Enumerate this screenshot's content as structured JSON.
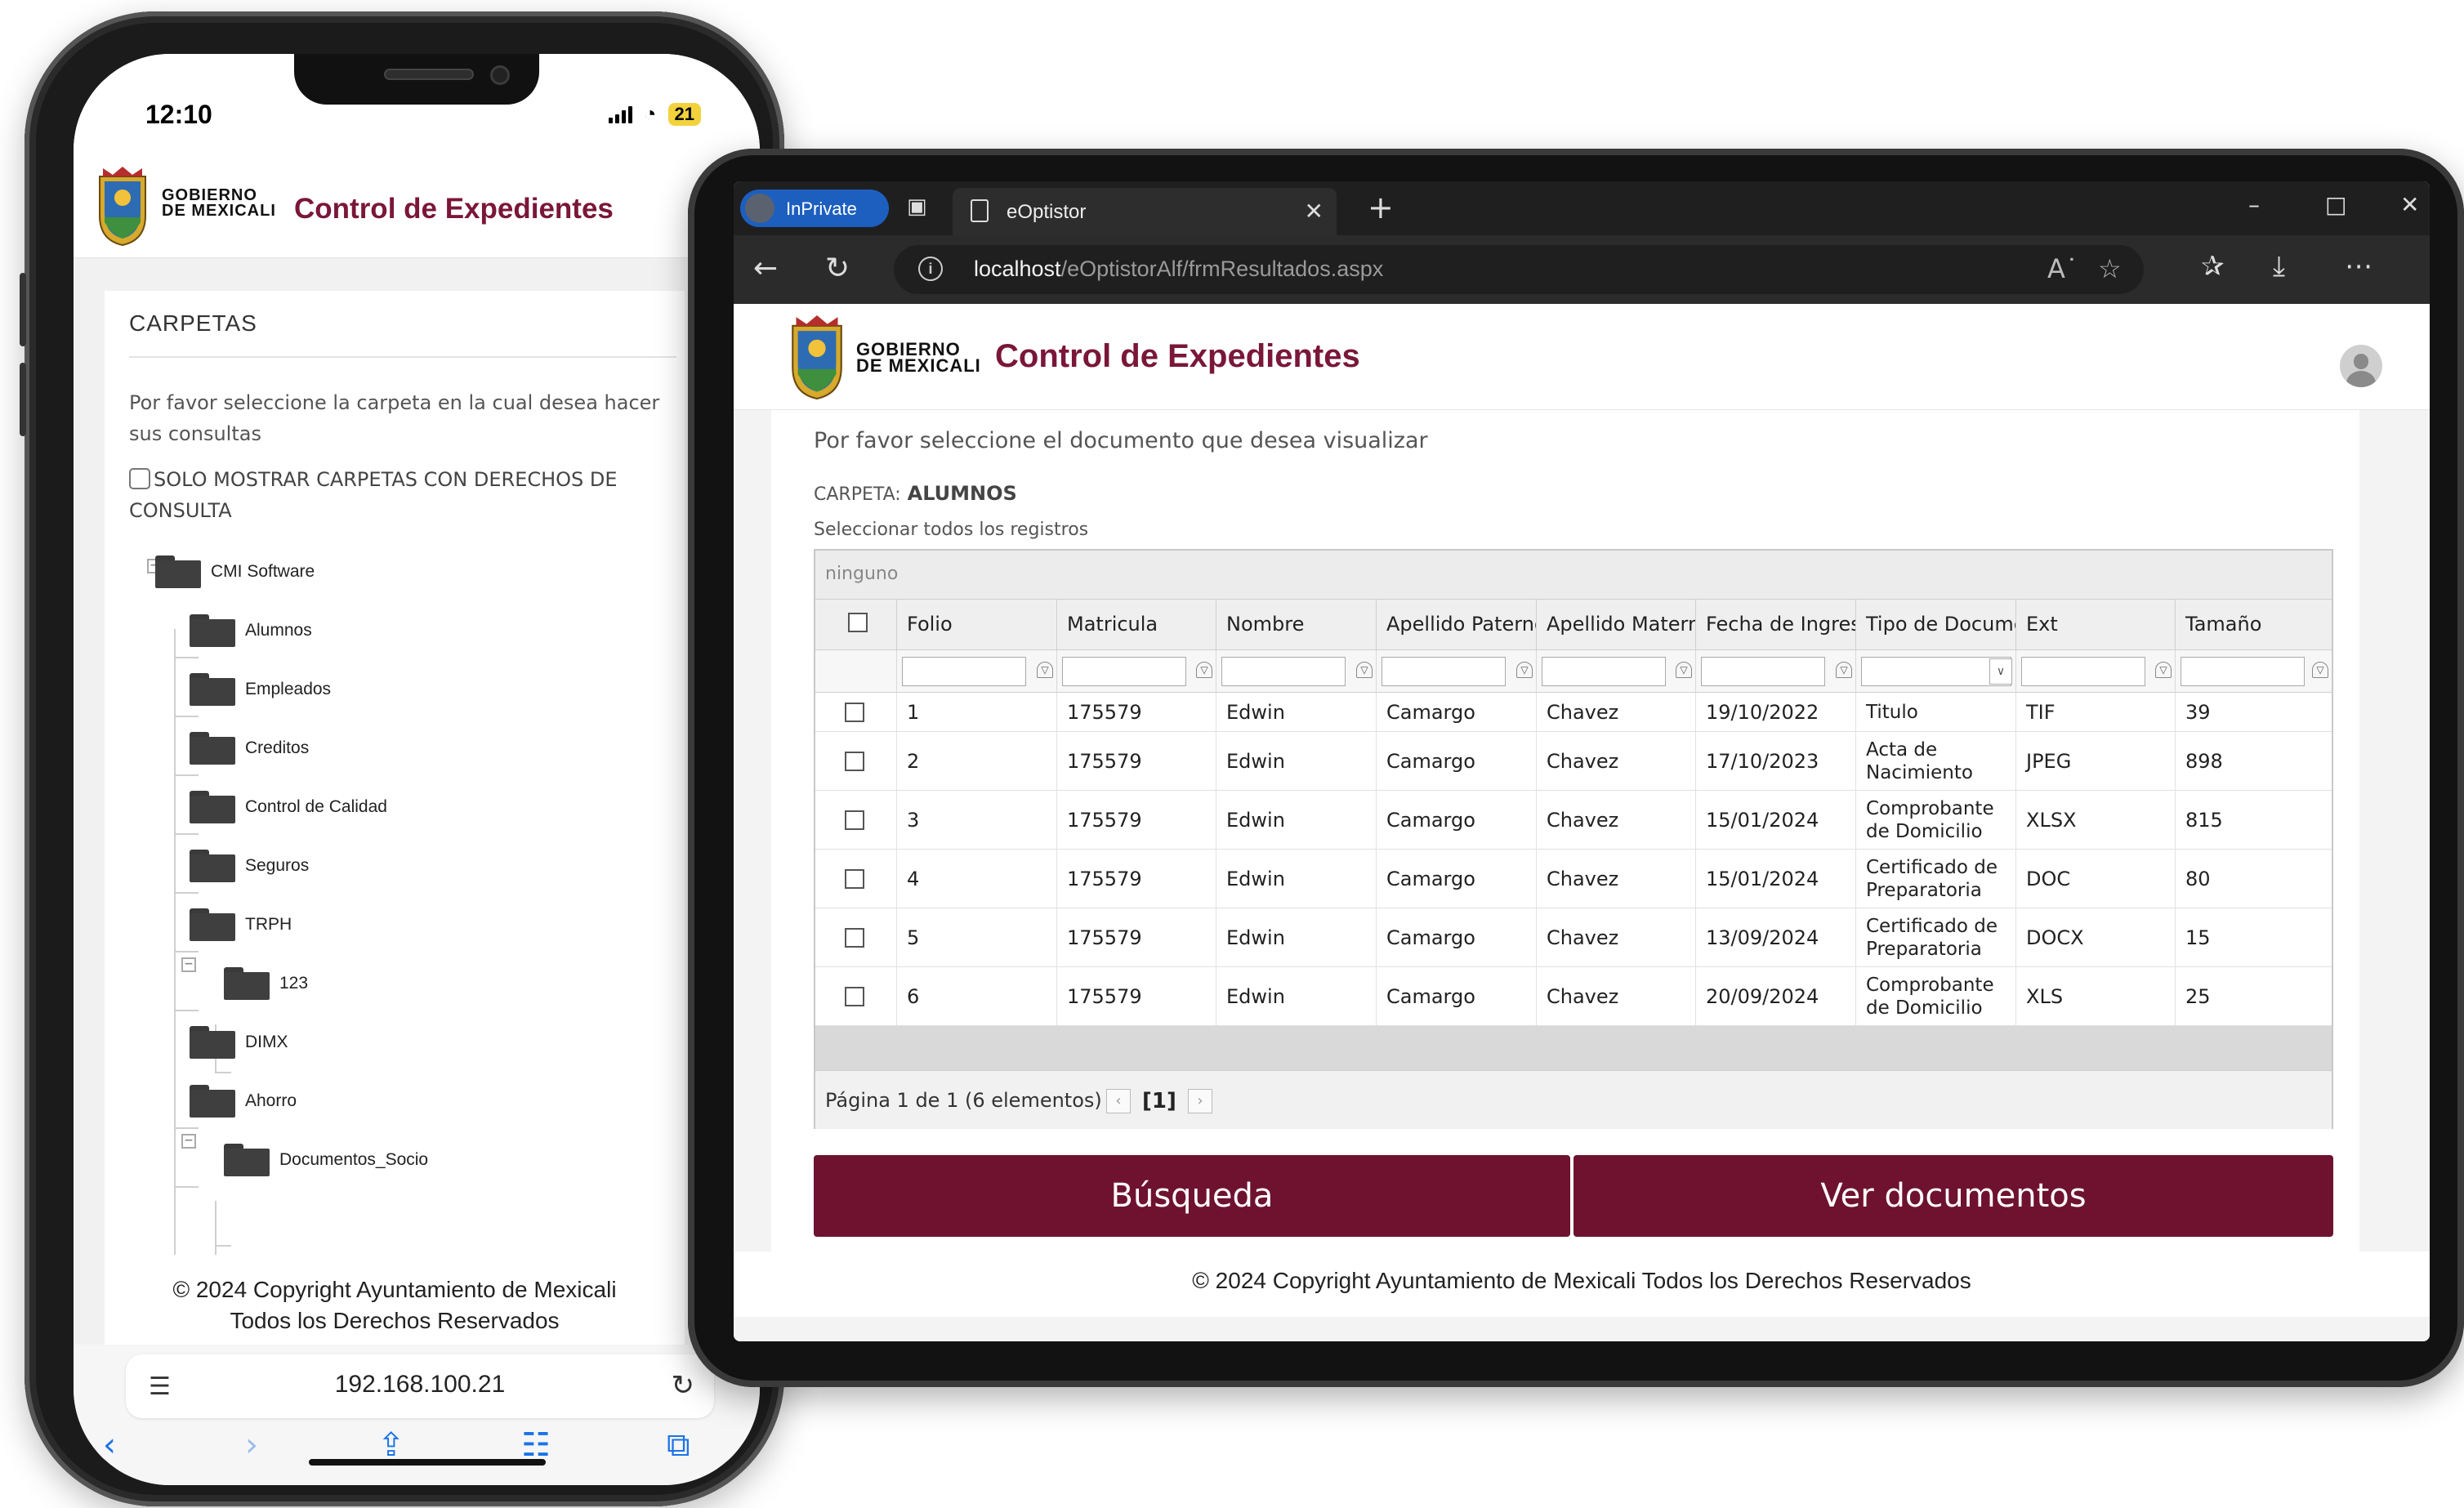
{
  "phone": {
    "status": {
      "time": "12:10",
      "battery": "21"
    },
    "header": {
      "gov_line1": "GOBIERNO",
      "gov_line2": "DE MEXICALI",
      "title": "Control de Expedientes"
    },
    "card": {
      "title": "CARPETAS",
      "instruction": "Por favor seleccione la carpeta en la cual desea hacer sus consultas",
      "checkbox_label": "SOLO MOSTRAR CARPETAS CON DERECHOS DE CONSULTA"
    },
    "tree": [
      {
        "label": "CMI Software"
      },
      {
        "label": "Alumnos"
      },
      {
        "label": "Empleados"
      },
      {
        "label": "Creditos"
      },
      {
        "label": "Control de Calidad"
      },
      {
        "label": "Seguros"
      },
      {
        "label": "TRPH"
      },
      {
        "label": "123"
      },
      {
        "label": "DIMX"
      },
      {
        "label": "Ahorro"
      },
      {
        "label": "Documentos_Socio"
      }
    ],
    "footer": {
      "line1": "© 2024 Copyright Ayuntamiento de Mexicali",
      "line2": "Todos los Derechos Reservados"
    },
    "url": "192.168.100.21"
  },
  "tablet": {
    "browser": {
      "inprivate": "InPrivate",
      "tab_title": "eOptistor",
      "url_host": "localhost",
      "url_path": "/eOptistorAlf/frmResultados.aspx"
    },
    "header": {
      "gov_line1": "GOBIERNO",
      "gov_line2": "DE MEXICALI",
      "title": "Control de Expedientes"
    },
    "prompt": "Por favor seleccione el documento que desea visualizar",
    "carpeta_label": "CARPETA:",
    "carpeta_value": "ALUMNOS",
    "select_all": "Seleccionar todos los registros",
    "grid": {
      "group_panel": "ninguno",
      "columns": [
        "Folio",
        "Matricula",
        "Nombre",
        "Apellido Paterno",
        "Apellido Materno",
        "Fecha de Ingreso",
        "Tipo de Documento",
        "Ext",
        "Tamaño"
      ],
      "rows": [
        [
          "1",
          "175579",
          "Edwin",
          "Camargo",
          "Chavez",
          "19/10/2022",
          "Titulo",
          "TIF",
          "39"
        ],
        [
          "2",
          "175579",
          "Edwin",
          "Camargo",
          "Chavez",
          "17/10/2023",
          "Acta de Nacimiento",
          "JPEG",
          "898"
        ],
        [
          "3",
          "175579",
          "Edwin",
          "Camargo",
          "Chavez",
          "15/01/2024",
          "Comprobante de Domicilio",
          "XLSX",
          "815"
        ],
        [
          "4",
          "175579",
          "Edwin",
          "Camargo",
          "Chavez",
          "15/01/2024",
          "Certificado de Preparatoria",
          "DOC",
          "80"
        ],
        [
          "5",
          "175579",
          "Edwin",
          "Camargo",
          "Chavez",
          "13/09/2024",
          "Certificado de Preparatoria",
          "DOCX",
          "15"
        ],
        [
          "6",
          "175579",
          "Edwin",
          "Camargo",
          "Chavez",
          "20/09/2024",
          "Comprobante de Domicilio",
          "XLS",
          "25"
        ]
      ],
      "pager_text": "Página 1 de 1 (6 elementos)",
      "pager_current": "[1]"
    },
    "buttons": {
      "search": "Búsqueda",
      "view": "Ver documentos"
    },
    "footer": "© 2024 Copyright Ayuntamiento de Mexicali Todos los Derechos Reservados"
  }
}
